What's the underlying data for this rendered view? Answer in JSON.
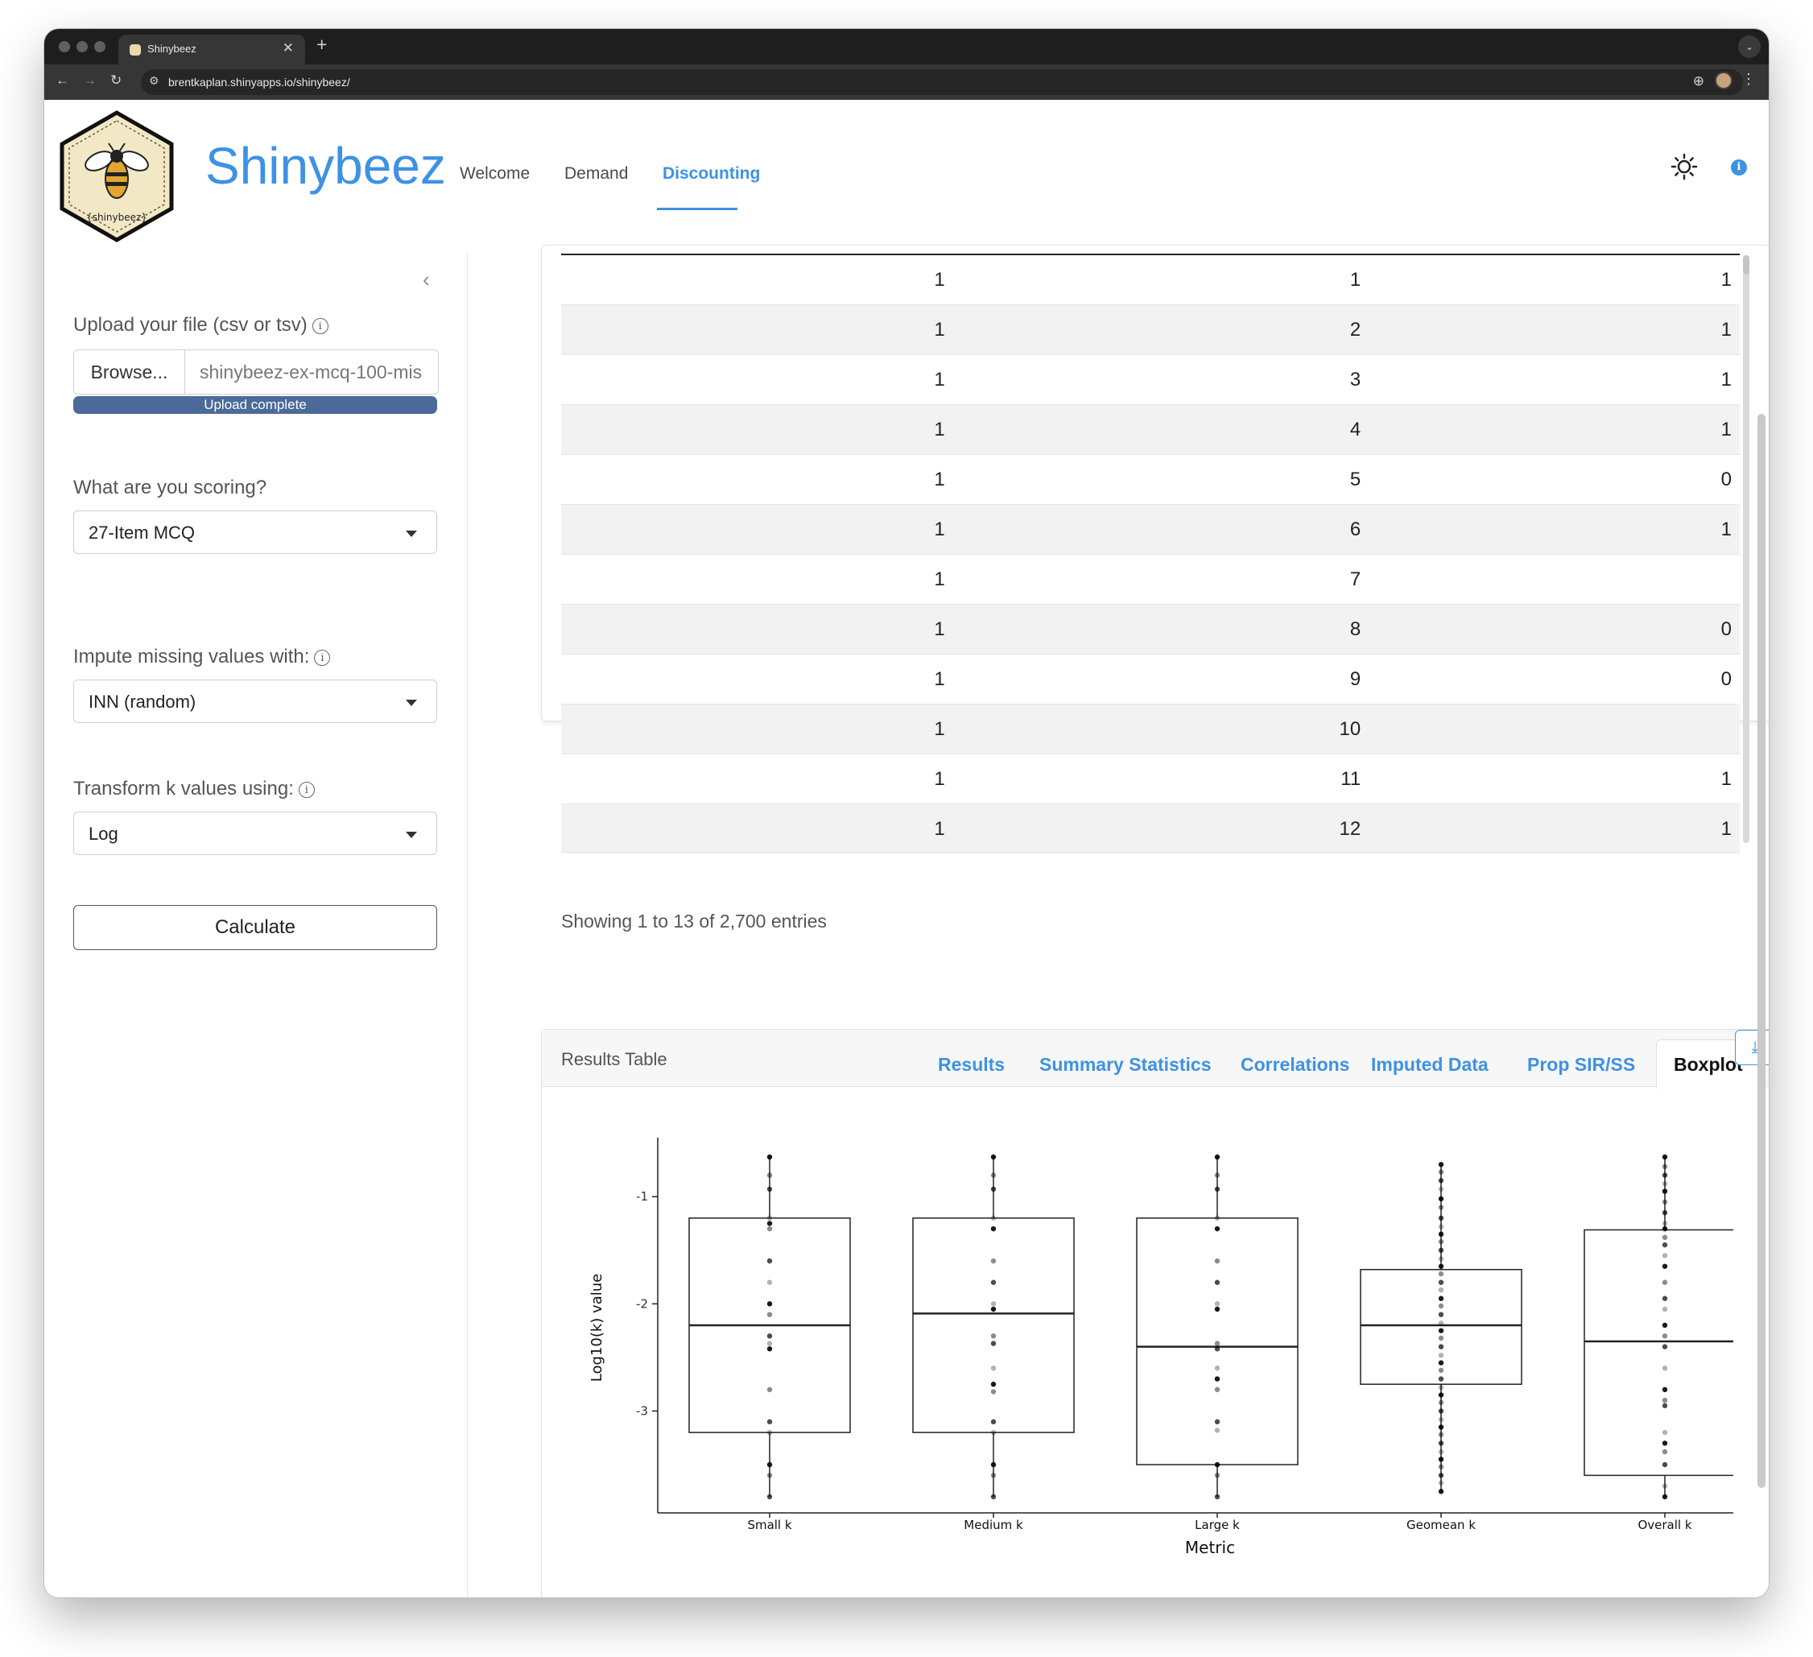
{
  "browser": {
    "tab_title": "Shinybeez",
    "url": "brentkaplan.shinyapps.io/shinybeez/"
  },
  "app": {
    "brand": "Shinybeez",
    "logo_text": "{shinybeez}",
    "nav": [
      "Welcome",
      "Demand",
      "Discounting"
    ],
    "active_nav": "Discounting"
  },
  "sidebar": {
    "upload_label": "Upload your file (csv or tsv)",
    "browse_label": "Browse...",
    "file_name": "shinybeez-ex-mcq-100-mis",
    "upload_status": "Upload complete",
    "scoring_label": "What are you scoring?",
    "scoring_value": "27-Item MCQ",
    "impute_label": "Impute missing values with:",
    "impute_value": "INN (random)",
    "transform_label": "Transform k values using:",
    "transform_value": "Log",
    "calculate_label": "Calculate"
  },
  "data_table": {
    "rows": [
      [
        "1",
        "1",
        "1"
      ],
      [
        "1",
        "2",
        "1"
      ],
      [
        "1",
        "3",
        "1"
      ],
      [
        "1",
        "4",
        "1"
      ],
      [
        "1",
        "5",
        "0"
      ],
      [
        "1",
        "6",
        "1"
      ],
      [
        "1",
        "7",
        ""
      ],
      [
        "1",
        "8",
        "0"
      ],
      [
        "1",
        "9",
        "0"
      ],
      [
        "1",
        "10",
        ""
      ],
      [
        "1",
        "11",
        "1"
      ],
      [
        "1",
        "12",
        "1"
      ]
    ],
    "info": "Showing 1 to 13 of 2,700 entries"
  },
  "results": {
    "title": "Results Table",
    "tabs": [
      "Results",
      "Summary Statistics",
      "Correlations",
      "Imputed Data",
      "Prop SIR/SS",
      "Boxplot"
    ],
    "active_tab": "Boxplot"
  },
  "chart_data": {
    "type": "boxplot",
    "xlabel": "Metric",
    "ylabel": "Log10(k) value",
    "categories": [
      "Small k",
      "Medium k",
      "Large k",
      "Geomean k",
      "Overall k"
    ],
    "yticks": [
      -1,
      -2,
      -3
    ],
    "ylim": [
      -3.95,
      -0.45
    ],
    "boxes": [
      {
        "name": "Small k",
        "q1": -3.2,
        "median": -2.2,
        "q3": -1.2
      },
      {
        "name": "Medium k",
        "q1": -3.2,
        "median": -2.09,
        "q3": -1.2
      },
      {
        "name": "Large k",
        "q1": -3.5,
        "median": -2.4,
        "q3": -1.2
      },
      {
        "name": "Geomean k",
        "q1": -2.75,
        "median": -2.2,
        "q3": -1.68
      },
      {
        "name": "Overall k",
        "q1": -3.6,
        "median": -2.35,
        "q3": -1.31
      }
    ],
    "points": [
      [
        -0.63,
        -0.8,
        -0.93,
        -1.2,
        -1.25,
        -1.3,
        -1.6,
        -1.8,
        -2.0,
        -2.1,
        -2.3,
        -2.37,
        -2.42,
        -2.8,
        -3.1,
        -3.2,
        -3.5,
        -3.6,
        -3.8
      ],
      [
        -0.63,
        -0.8,
        -0.93,
        -1.2,
        -1.3,
        -1.6,
        -1.8,
        -2.0,
        -2.05,
        -2.3,
        -2.37,
        -2.6,
        -2.75,
        -2.82,
        -3.1,
        -3.2,
        -3.5,
        -3.6,
        -3.8
      ],
      [
        -0.63,
        -0.8,
        -0.93,
        -1.2,
        -1.3,
        -1.6,
        -1.8,
        -2.0,
        -2.05,
        -2.37,
        -2.42,
        -2.6,
        -2.7,
        -2.8,
        -3.1,
        -3.18,
        -3.5,
        -3.6,
        -3.8
      ],
      [
        -0.7,
        -0.77,
        -0.85,
        -0.93,
        -1.02,
        -1.1,
        -1.2,
        -1.28,
        -1.35,
        -1.42,
        -1.5,
        -1.58,
        -1.65,
        -1.72,
        -1.8,
        -1.87,
        -1.95,
        -2.02,
        -2.1,
        -2.18,
        -2.25,
        -2.32,
        -2.4,
        -2.48,
        -2.55,
        -2.62,
        -2.7,
        -2.78,
        -2.85,
        -2.92,
        -3.0,
        -3.08,
        -3.15,
        -3.22,
        -3.3,
        -3.38,
        -3.45,
        -3.52,
        -3.6,
        -3.67,
        -3.75
      ],
      [
        -0.63,
        -0.72,
        -0.8,
        -0.88,
        -0.95,
        -1.05,
        -1.15,
        -1.25,
        -1.3,
        -1.38,
        -1.45,
        -1.55,
        -1.65,
        -1.8,
        -1.95,
        -2.05,
        -2.2,
        -2.3,
        -2.4,
        -2.6,
        -2.8,
        -2.9,
        -2.95,
        -3.2,
        -3.3,
        -3.38,
        -3.5,
        -3.7,
        -3.8
      ]
    ]
  }
}
